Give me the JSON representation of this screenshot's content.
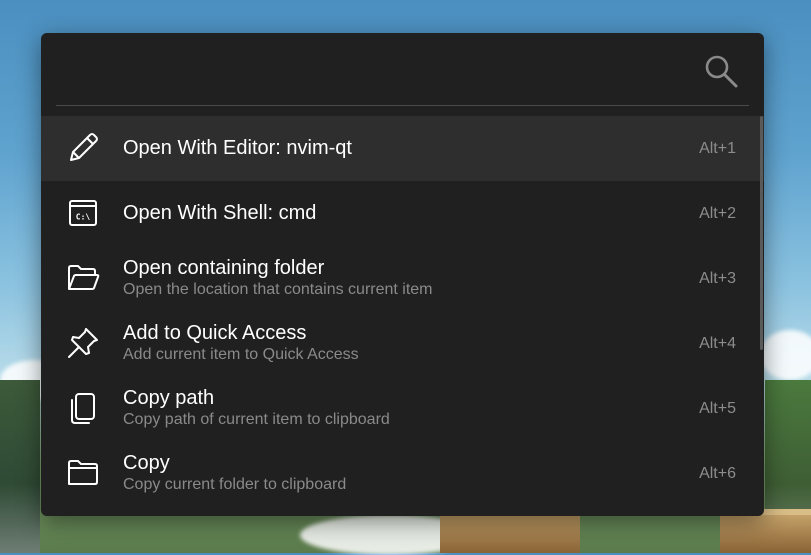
{
  "search": {
    "value": "",
    "placeholder": "",
    "icon": "search-icon"
  },
  "results": [
    {
      "title": "Open With Editor: nvim-qt",
      "subtitle": "",
      "shortcut": "Alt+1",
      "icon": "pencil-icon",
      "selected": true
    },
    {
      "title": "Open With Shell: cmd",
      "subtitle": "",
      "shortcut": "Alt+2",
      "icon": "terminal-icon",
      "selected": false
    },
    {
      "title": "Open containing folder",
      "subtitle": "Open the location that contains current item",
      "shortcut": "Alt+3",
      "icon": "folder-open-icon",
      "selected": false
    },
    {
      "title": "Add to Quick Access",
      "subtitle": "Add current item to Quick Access",
      "shortcut": "Alt+4",
      "icon": "pin-icon",
      "selected": false
    },
    {
      "title": "Copy path",
      "subtitle": "Copy path of current item to clipboard",
      "shortcut": "Alt+5",
      "icon": "copy-icon",
      "selected": false
    },
    {
      "title": "Copy",
      "subtitle": "Copy current folder to clipboard",
      "shortcut": "Alt+6",
      "icon": "folder-icon",
      "selected": false
    }
  ],
  "colors": {
    "panel_background": "#202020",
    "selected_row": "#2e2e2e",
    "title_text": "#ffffff",
    "subtitle_text": "#8a8a8a",
    "shortcut_text": "#8c8c8c"
  }
}
